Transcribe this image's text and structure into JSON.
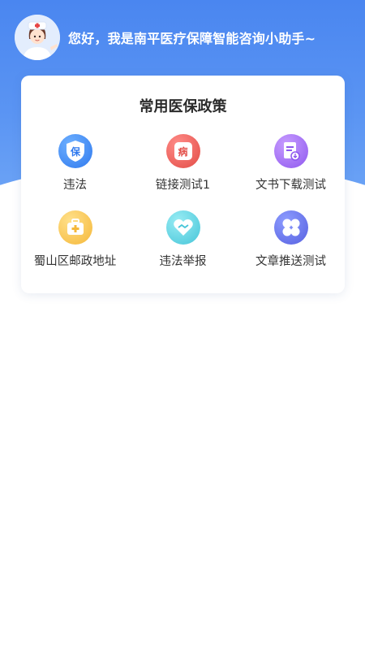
{
  "header": {
    "greeting": "您好，我是南平医疗保障智能咨询小助手~"
  },
  "card": {
    "title": "常用医保政策",
    "items": [
      {
        "label": "违法",
        "icon": "shield-bao-icon",
        "glyph": "保",
        "color": "#2f79ee"
      },
      {
        "label": "链接测试1",
        "icon": "disease-icon",
        "glyph": "病",
        "color": "#e24b45"
      },
      {
        "label": "文书下载测试",
        "icon": "document-icon",
        "glyph": "",
        "color": "#8e58ee"
      },
      {
        "label": "蜀山区邮政地址",
        "icon": "medical-kit-icon",
        "glyph": "",
        "color": "#f5b83a"
      },
      {
        "label": "违法举报",
        "icon": "handshake-heart-icon",
        "glyph": "",
        "color": "#46c5d8"
      },
      {
        "label": "文章推送测试",
        "icon": "clover-icon",
        "glyph": "",
        "color": "#5660e0"
      }
    ]
  }
}
